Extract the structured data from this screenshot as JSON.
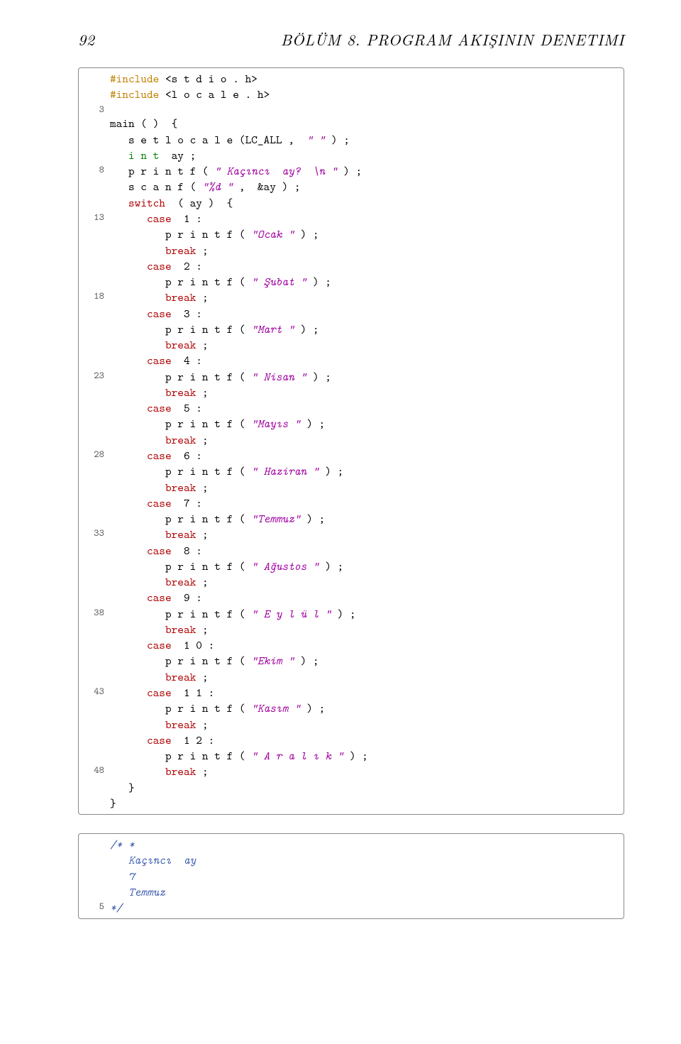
{
  "header": {
    "page_number": "92",
    "chapter_title": "BÖLÜM 8. PROGRAM AKIŞININ DENETIMI"
  },
  "block1": {
    "lines": [
      {
        "n": "",
        "seg": [
          [
            "kw-pp",
            "#include "
          ],
          [
            "plain",
            "<s t d i o . h>"
          ]
        ]
      },
      {
        "n": "",
        "seg": [
          [
            "kw-pp",
            "#include "
          ],
          [
            "plain",
            "<l o c a l e . h>"
          ]
        ]
      },
      {
        "n": "3",
        "seg": [
          [
            "plain",
            ""
          ]
        ]
      },
      {
        "n": "",
        "seg": [
          [
            "plain",
            "main ( )  {"
          ]
        ]
      },
      {
        "n": "",
        "seg": [
          [
            "plain",
            "   s e t l o c a l e (LC_ALL ,  "
          ],
          [
            "str",
            "\" \""
          ],
          [
            "plain",
            " ) ;"
          ]
        ]
      },
      {
        "n": "",
        "seg": [
          [
            "plain",
            "   "
          ],
          [
            "kw-green",
            "i n t"
          ],
          [
            "plain",
            "  ay ;"
          ]
        ]
      },
      {
        "n": "",
        "seg": [
          [
            "plain",
            ""
          ]
        ]
      },
      {
        "n": "8",
        "seg": [
          [
            "plain",
            "   p r i n t f ( "
          ],
          [
            "str",
            "\" Kaçıncı  ay?  \\n \""
          ],
          [
            "plain",
            " ) ;"
          ]
        ]
      },
      {
        "n": "",
        "seg": [
          [
            "plain",
            "   s c a n f ( "
          ],
          [
            "str",
            "\"%d \""
          ],
          [
            "plain",
            " ,  &ay ) ;"
          ]
        ]
      },
      {
        "n": "",
        "seg": [
          [
            "plain",
            ""
          ]
        ]
      },
      {
        "n": "",
        "seg": [
          [
            "plain",
            ""
          ]
        ]
      },
      {
        "n": "",
        "seg": [
          [
            "plain",
            "   "
          ],
          [
            "kw-red",
            "switch"
          ],
          [
            "plain",
            "  ( ay )  {"
          ]
        ]
      },
      {
        "n": "13",
        "seg": [
          [
            "plain",
            "      "
          ],
          [
            "kw-red",
            "case"
          ],
          [
            "plain",
            "  1 :"
          ]
        ]
      },
      {
        "n": "",
        "seg": [
          [
            "plain",
            "         p r i n t f ( "
          ],
          [
            "str",
            "\"Ocak \""
          ],
          [
            "plain",
            " ) ;"
          ]
        ]
      },
      {
        "n": "",
        "seg": [
          [
            "plain",
            "         "
          ],
          [
            "kw-red",
            "break"
          ],
          [
            "plain",
            " ;"
          ]
        ]
      },
      {
        "n": "",
        "seg": [
          [
            "plain",
            "      "
          ],
          [
            "kw-red",
            "case"
          ],
          [
            "plain",
            "  2 :"
          ]
        ]
      },
      {
        "n": "",
        "seg": [
          [
            "plain",
            "         p r i n t f ( "
          ],
          [
            "str",
            "\" Şubat \""
          ],
          [
            "plain",
            " ) ;"
          ]
        ]
      },
      {
        "n": "18",
        "seg": [
          [
            "plain",
            "         "
          ],
          [
            "kw-red",
            "break"
          ],
          [
            "plain",
            " ;"
          ]
        ]
      },
      {
        "n": "",
        "seg": [
          [
            "plain",
            "      "
          ],
          [
            "kw-red",
            "case"
          ],
          [
            "plain",
            "  3 :"
          ]
        ]
      },
      {
        "n": "",
        "seg": [
          [
            "plain",
            "         p r i n t f ( "
          ],
          [
            "str",
            "\"Mart \""
          ],
          [
            "plain",
            " ) ;"
          ]
        ]
      },
      {
        "n": "",
        "seg": [
          [
            "plain",
            "         "
          ],
          [
            "kw-red",
            "break"
          ],
          [
            "plain",
            " ;"
          ]
        ]
      },
      {
        "n": "",
        "seg": [
          [
            "plain",
            "      "
          ],
          [
            "kw-red",
            "case"
          ],
          [
            "plain",
            "  4 :"
          ]
        ]
      },
      {
        "n": "23",
        "seg": [
          [
            "plain",
            "         p r i n t f ( "
          ],
          [
            "str",
            "\" Nisan \""
          ],
          [
            "plain",
            " ) ;"
          ]
        ]
      },
      {
        "n": "",
        "seg": [
          [
            "plain",
            "         "
          ],
          [
            "kw-red",
            "break"
          ],
          [
            "plain",
            " ;"
          ]
        ]
      },
      {
        "n": "",
        "seg": [
          [
            "plain",
            "      "
          ],
          [
            "kw-red",
            "case"
          ],
          [
            "plain",
            "  5 :"
          ]
        ]
      },
      {
        "n": "",
        "seg": [
          [
            "plain",
            "         p r i n t f ( "
          ],
          [
            "str",
            "\"Mayıs \""
          ],
          [
            "plain",
            " ) ;"
          ]
        ]
      },
      {
        "n": "",
        "seg": [
          [
            "plain",
            "         "
          ],
          [
            "kw-red",
            "break"
          ],
          [
            "plain",
            " ;"
          ]
        ]
      },
      {
        "n": "28",
        "seg": [
          [
            "plain",
            "      "
          ],
          [
            "kw-red",
            "case"
          ],
          [
            "plain",
            "  6 :"
          ]
        ]
      },
      {
        "n": "",
        "seg": [
          [
            "plain",
            "         p r i n t f ( "
          ],
          [
            "str",
            "\" Haziran \""
          ],
          [
            "plain",
            " ) ;"
          ]
        ]
      },
      {
        "n": "",
        "seg": [
          [
            "plain",
            "         "
          ],
          [
            "kw-red",
            "break"
          ],
          [
            "plain",
            " ;"
          ]
        ]
      },
      {
        "n": "",
        "seg": [
          [
            "plain",
            "      "
          ],
          [
            "kw-red",
            "case"
          ],
          [
            "plain",
            "  7 :"
          ]
        ]
      },
      {
        "n": "",
        "seg": [
          [
            "plain",
            "         p r i n t f ( "
          ],
          [
            "str",
            "\"Temmuz\""
          ],
          [
            "plain",
            " ) ;"
          ]
        ]
      },
      {
        "n": "33",
        "seg": [
          [
            "plain",
            "         "
          ],
          [
            "kw-red",
            "break"
          ],
          [
            "plain",
            " ;"
          ]
        ]
      },
      {
        "n": "",
        "seg": [
          [
            "plain",
            "      "
          ],
          [
            "kw-red",
            "case"
          ],
          [
            "plain",
            "  8 :"
          ]
        ]
      },
      {
        "n": "",
        "seg": [
          [
            "plain",
            "         p r i n t f ( "
          ],
          [
            "str",
            "\" Ağustos \""
          ],
          [
            "plain",
            " ) ;"
          ]
        ]
      },
      {
        "n": "",
        "seg": [
          [
            "plain",
            "         "
          ],
          [
            "kw-red",
            "break"
          ],
          [
            "plain",
            " ;"
          ]
        ]
      },
      {
        "n": "",
        "seg": [
          [
            "plain",
            "      "
          ],
          [
            "kw-red",
            "case"
          ],
          [
            "plain",
            "  9 :"
          ]
        ]
      },
      {
        "n": "38",
        "seg": [
          [
            "plain",
            "         p r i n t f ( "
          ],
          [
            "str",
            "\" E y l ü l \""
          ],
          [
            "plain",
            " ) ;"
          ]
        ]
      },
      {
        "n": "",
        "seg": [
          [
            "plain",
            "         "
          ],
          [
            "kw-red",
            "break"
          ],
          [
            "plain",
            " ;"
          ]
        ]
      },
      {
        "n": "",
        "seg": [
          [
            "plain",
            "      "
          ],
          [
            "kw-red",
            "case"
          ],
          [
            "plain",
            "  1 0 :"
          ]
        ]
      },
      {
        "n": "",
        "seg": [
          [
            "plain",
            "         p r i n t f ( "
          ],
          [
            "str",
            "\"Ekim \""
          ],
          [
            "plain",
            " ) ;"
          ]
        ]
      },
      {
        "n": "",
        "seg": [
          [
            "plain",
            "         "
          ],
          [
            "kw-red",
            "break"
          ],
          [
            "plain",
            " ;"
          ]
        ]
      },
      {
        "n": "43",
        "seg": [
          [
            "plain",
            "      "
          ],
          [
            "kw-red",
            "case"
          ],
          [
            "plain",
            "  1 1 :"
          ]
        ]
      },
      {
        "n": "",
        "seg": [
          [
            "plain",
            "         p r i n t f ( "
          ],
          [
            "str",
            "\"Kasım \""
          ],
          [
            "plain",
            " ) ;"
          ]
        ]
      },
      {
        "n": "",
        "seg": [
          [
            "plain",
            "         "
          ],
          [
            "kw-red",
            "break"
          ],
          [
            "plain",
            " ;"
          ]
        ]
      },
      {
        "n": "",
        "seg": [
          [
            "plain",
            "      "
          ],
          [
            "kw-red",
            "case"
          ],
          [
            "plain",
            "  1 2 :"
          ]
        ]
      },
      {
        "n": "",
        "seg": [
          [
            "plain",
            "         p r i n t f ( "
          ],
          [
            "str",
            "\" A r a l ı k \""
          ],
          [
            "plain",
            " ) ;"
          ]
        ]
      },
      {
        "n": "48",
        "seg": [
          [
            "plain",
            "         "
          ],
          [
            "kw-red",
            "break"
          ],
          [
            "plain",
            " ;"
          ]
        ]
      },
      {
        "n": "",
        "seg": [
          [
            "plain",
            "   }"
          ]
        ]
      },
      {
        "n": "",
        "seg": [
          [
            "plain",
            "}"
          ]
        ]
      }
    ]
  },
  "block2": {
    "lines": [
      {
        "n": "",
        "seg": [
          [
            "comment",
            "/∗ ∗"
          ]
        ]
      },
      {
        "n": "",
        "seg": [
          [
            "comment",
            "   Kaçıncı  ay"
          ]
        ]
      },
      {
        "n": "",
        "seg": [
          [
            "comment",
            "   7"
          ]
        ]
      },
      {
        "n": "",
        "seg": [
          [
            "comment",
            "   Temmuz"
          ]
        ]
      },
      {
        "n": "5",
        "seg": [
          [
            "comment",
            "∗/"
          ]
        ]
      }
    ]
  }
}
